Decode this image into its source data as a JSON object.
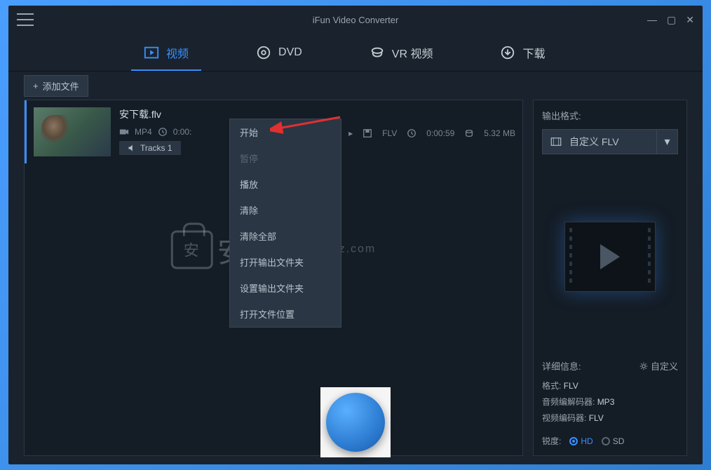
{
  "app_title": "iFun Video Converter",
  "tabs": {
    "video": "视频",
    "dvd": "DVD",
    "vr": "VR 视频",
    "download": "下载"
  },
  "toolbar": {
    "add_file": "添加文件"
  },
  "file": {
    "name": "安下载.flv",
    "src_format": "MP4",
    "src_duration": "0:00:",
    "out_format": "FLV",
    "out_duration": "0:00:59",
    "out_size": "5.32 MB",
    "tracks": "Tracks 1"
  },
  "context_menu": {
    "start": "开始",
    "pause": "暂停",
    "play": "播放",
    "clear": "清除",
    "clear_all": "清除全部",
    "open_output_folder": "打开输出文件夹",
    "set_output_folder": "设置输出文件夹",
    "open_file_location": "打开文件位置"
  },
  "sidebar": {
    "output_format_label": "输出格式:",
    "format_selected": "自定义 FLV",
    "details_label": "详细信息:",
    "custom_label": "自定义",
    "format_key": "格式:",
    "format_val": "FLV",
    "audio_codec_key": "音频编解码器:",
    "audio_codec_val": "MP3",
    "video_codec_key": "视频编码器:",
    "video_codec_val": "FLV",
    "sharpness_label": "锐度:",
    "hd": "HD",
    "sd": "SD"
  },
  "watermark": {
    "text": "安下载",
    "domain": "anxz.com"
  }
}
